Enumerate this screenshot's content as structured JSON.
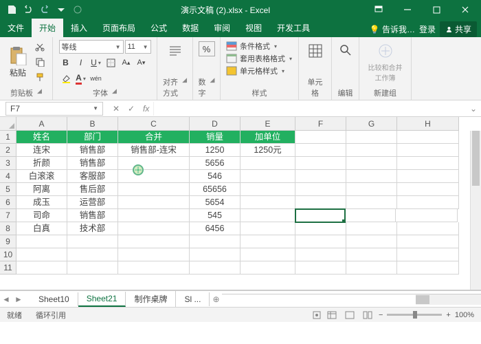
{
  "app": {
    "title": "演示文稿 (2).xlsx - Excel"
  },
  "tabs": {
    "file": "文件",
    "home": "开始",
    "insert": "插入",
    "layout": "页面布局",
    "formula": "公式",
    "data": "数据",
    "review": "审阅",
    "view": "视图",
    "dev": "开发工具",
    "tell": "告诉我…",
    "login": "登录",
    "share": "共享"
  },
  "ribbon": {
    "clipboard": {
      "label": "剪贴板",
      "paste": "粘贴"
    },
    "font": {
      "label": "字体",
      "family": "等线",
      "size": "11"
    },
    "align": {
      "label": "对齐方式"
    },
    "number": {
      "label": "数字"
    },
    "styles": {
      "label": "样式",
      "cond": "条件格式",
      "table": "套用表格格式",
      "cell": "单元格样式"
    },
    "cells": {
      "label": "单元格"
    },
    "editing": {
      "label": "编辑"
    },
    "newgroup": {
      "label": "新建组",
      "compare": "比较和合并工作簿"
    }
  },
  "namebox": "F7",
  "cols": [
    "A",
    "B",
    "C",
    "D",
    "E",
    "F",
    "G",
    "H"
  ],
  "widths": [
    "cw-A",
    "cw-B",
    "cw-C",
    "cw-D",
    "cw-E",
    "cw-F",
    "cw-G",
    "cw-H"
  ],
  "headers": [
    "姓名",
    "部门",
    "合并",
    "销量",
    "加单位"
  ],
  "chart_data": {
    "type": "table",
    "columns": [
      "姓名",
      "部门",
      "合并",
      "销量",
      "加单位"
    ],
    "rows": [
      {
        "姓名": "连宋",
        "部门": "销售部",
        "合并": "销售部-连宋",
        "销量": 1250,
        "加单位": "1250元"
      },
      {
        "姓名": "折颜",
        "部门": "销售部",
        "合并": "",
        "销量": 5656,
        "加单位": ""
      },
      {
        "姓名": "白滚滚",
        "部门": "客服部",
        "合并": "",
        "销量": 546,
        "加单位": ""
      },
      {
        "姓名": "阿离",
        "部门": "售后部",
        "合并": "",
        "销量": 65656,
        "加单位": ""
      },
      {
        "姓名": "成玉",
        "部门": "运营部",
        "合并": "",
        "销量": 5654,
        "加单位": ""
      },
      {
        "姓名": "司命",
        "部门": "销售部",
        "合并": "",
        "销量": 545,
        "加单位": ""
      },
      {
        "姓名": "白真",
        "部门": "技术部",
        "合并": "",
        "销量": 6456,
        "加单位": ""
      }
    ]
  },
  "sheets": {
    "s1": "Sheet10",
    "s2": "Sheet21",
    "s3": "制作桌牌",
    "s4": "Sl ...",
    "add": "⊕"
  },
  "status": {
    "ready": "就绪",
    "circ": "循环引用",
    "zoom": "100%"
  }
}
